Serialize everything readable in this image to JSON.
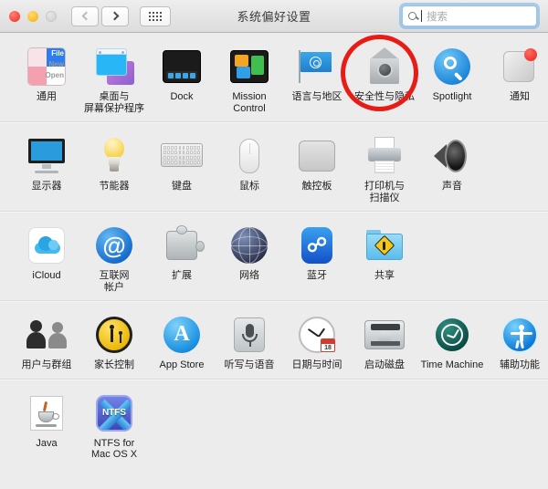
{
  "window": {
    "title": "系统偏好设置",
    "traffic_lights": [
      "close",
      "minimize",
      "zoom-disabled"
    ],
    "nav": {
      "back_label": "back",
      "forward_label": "forward",
      "grid_label": "show-all"
    }
  },
  "search": {
    "placeholder": "搜索",
    "value": "",
    "icon": "search-icon",
    "focused": true
  },
  "annotation": {
    "shape": "ellipse",
    "color": "#e81c16",
    "target": "安全性与隐私"
  },
  "sections": [
    {
      "name": "personal",
      "items": [
        {
          "label": "通用",
          "icon": "general-icon"
        },
        {
          "label": "桌面与\n屏幕保护程序",
          "icon": "desktop-screensaver-icon"
        },
        {
          "label": "Dock",
          "icon": "dock-icon"
        },
        {
          "label": "Mission\nControl",
          "icon": "mission-control-icon"
        },
        {
          "label": "语言与地区",
          "icon": "language-region-icon"
        },
        {
          "label": "安全性与隐私",
          "icon": "security-privacy-icon"
        },
        {
          "label": "Spotlight",
          "icon": "spotlight-icon"
        },
        {
          "label": "通知",
          "icon": "notifications-icon"
        }
      ]
    },
    {
      "name": "hardware",
      "items": [
        {
          "label": "显示器",
          "icon": "displays-icon"
        },
        {
          "label": "节能器",
          "icon": "energy-saver-icon"
        },
        {
          "label": "键盘",
          "icon": "keyboard-icon"
        },
        {
          "label": "鼠标",
          "icon": "mouse-icon"
        },
        {
          "label": "触控板",
          "icon": "trackpad-icon"
        },
        {
          "label": "打印机与\n扫描仪",
          "icon": "printers-scanners-icon"
        },
        {
          "label": "声音",
          "icon": "sound-icon"
        }
      ]
    },
    {
      "name": "internet-wireless",
      "items": [
        {
          "label": "iCloud",
          "icon": "icloud-icon"
        },
        {
          "label": "互联网\n帐户",
          "icon": "internet-accounts-icon"
        },
        {
          "label": "扩展",
          "icon": "extensions-icon"
        },
        {
          "label": "网络",
          "icon": "network-icon"
        },
        {
          "label": "蓝牙",
          "icon": "bluetooth-icon"
        },
        {
          "label": "共享",
          "icon": "sharing-icon"
        }
      ]
    },
    {
      "name": "system",
      "items": [
        {
          "label": "用户与群组",
          "icon": "users-groups-icon"
        },
        {
          "label": "家长控制",
          "icon": "parental-controls-icon"
        },
        {
          "label": "App Store",
          "icon": "app-store-icon"
        },
        {
          "label": "听写与语音",
          "icon": "dictation-speech-icon"
        },
        {
          "label": "日期与时间",
          "icon": "date-time-icon"
        },
        {
          "label": "启动磁盘",
          "icon": "startup-disk-icon"
        },
        {
          "label": "Time Machine",
          "icon": "time-machine-icon"
        },
        {
          "label": "辅助功能",
          "icon": "accessibility-icon"
        }
      ]
    },
    {
      "name": "other",
      "items": [
        {
          "label": "Java",
          "icon": "java-icon"
        },
        {
          "label": "NTFS for\nMac OS X",
          "icon": "ntfs-icon"
        }
      ]
    }
  ],
  "date_badge": "18"
}
